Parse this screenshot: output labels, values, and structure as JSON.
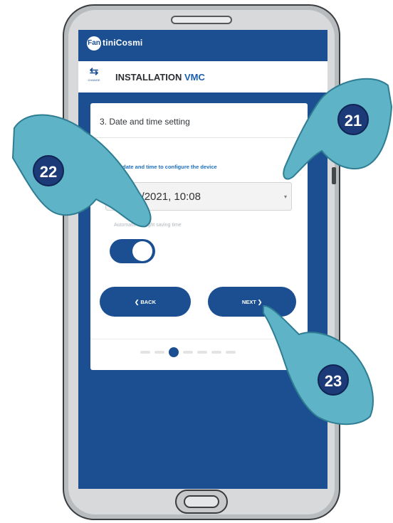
{
  "app": {
    "logo_mark": "Fan",
    "logo_text": "tiniCosmi",
    "header_icon_caption": "CHANGE",
    "title_main": "INSTALLATION ",
    "title_accent": "VMC"
  },
  "step": {
    "title": "3. Date and time setting",
    "field_label": "Select date and time to configure the device",
    "datetime_value": "19/10/2021, 10:08",
    "dst_label": "Automatic daylight saving time",
    "dst_enabled": true,
    "back_label": "❮ BACK",
    "next_label": "NEXT ❯",
    "progress": {
      "total_steps": 7,
      "current_step": 3
    }
  },
  "callouts": [
    "21",
    "22",
    "23"
  ],
  "colors": {
    "brand_blue": "#1b4f91",
    "accent_blue": "#1b6fc0",
    "hand_fill": "#5fb3c7",
    "badge": "#1d3a78"
  },
  "icons": [
    "change-device-icon",
    "chevron-down-icon",
    "chevron-left-icon",
    "chevron-right-icon",
    "pointing-hand-icon"
  ]
}
